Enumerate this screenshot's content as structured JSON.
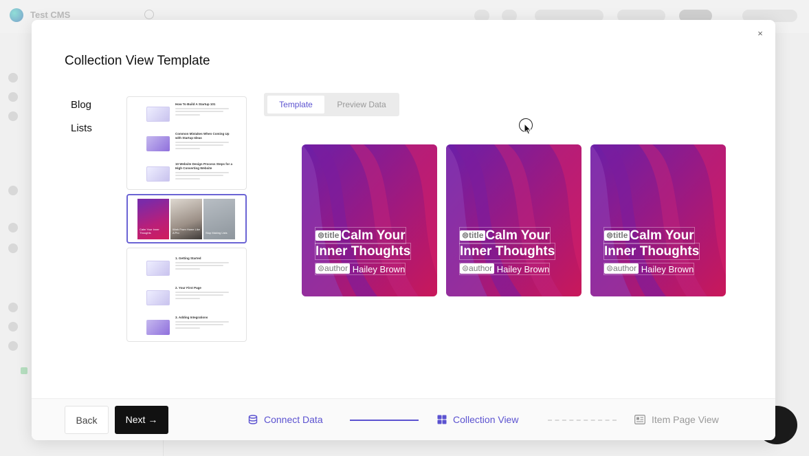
{
  "background": {
    "app_title": "Test CMS"
  },
  "modal": {
    "title": "Collection View Template",
    "close_label": "×"
  },
  "categories": [
    {
      "label": "Blog"
    },
    {
      "label": "Lists"
    }
  ],
  "templates": {
    "list_card_1": [
      {
        "title": "How To Build A Startup 101"
      },
      {
        "title": "Common Mistakes When Coming Up with Startup Ideas"
      },
      {
        "title": "10 Website Design Process Steps for a High Converting Website"
      }
    ],
    "grid_card": [
      {
        "title": "Calm Your Inner Thoughts"
      },
      {
        "title": "Work From Home Like A Pro"
      },
      {
        "title": "Stop Making Lists"
      }
    ],
    "list_card_2": [
      {
        "title": "1. Getting Started"
      },
      {
        "title": "2. Your First Page"
      },
      {
        "title": "3. Adding Integrations"
      }
    ]
  },
  "tabs": {
    "template": "Template",
    "preview_data": "Preview Data"
  },
  "preview": {
    "title_tag": "⊜title",
    "title_line1": "Calm Your",
    "title_line2": "Inner Thoughts",
    "author_tag": "⊜author",
    "author_name": "Hailey Brown"
  },
  "footer": {
    "back_label": "Back",
    "next_label": "Next →",
    "steps": [
      {
        "label": "Connect Data",
        "status": "done"
      },
      {
        "label": "Collection View",
        "status": "current"
      },
      {
        "label": "Item Page View",
        "status": "pending"
      }
    ]
  },
  "colors": {
    "accent": "#5b52d0",
    "card_gradient_start": "#7a1fa2",
    "card_gradient_end": "#c2185b"
  }
}
